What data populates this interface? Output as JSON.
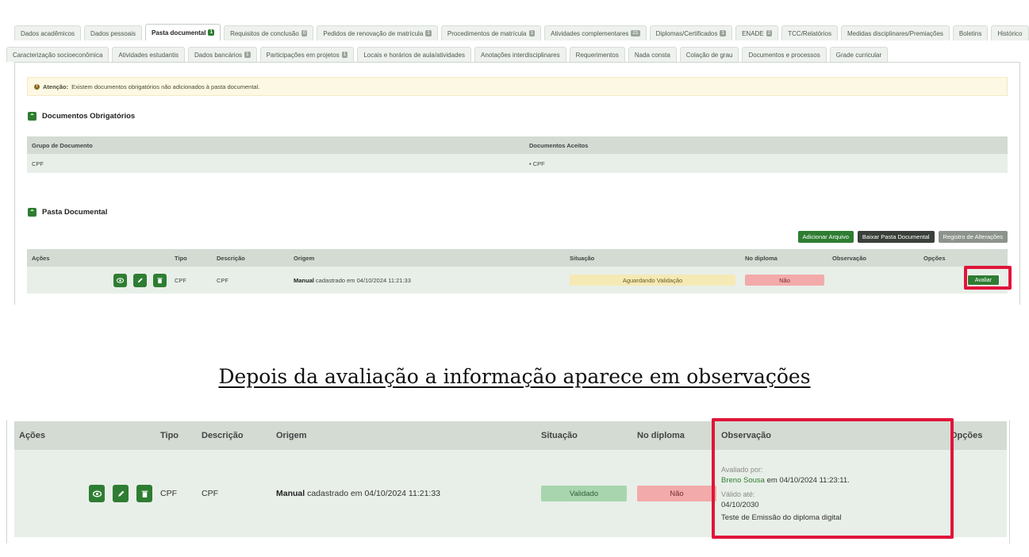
{
  "tabs_row1": [
    {
      "label": "Dados acadêmicos"
    },
    {
      "label": "Dados pessoais"
    },
    {
      "label": "Pasta documental",
      "badge": "1",
      "active": true
    },
    {
      "label": "Requisitos de conclusão",
      "badge": "0"
    },
    {
      "label": "Pedidos de renovação de matrícula",
      "badge": "1"
    },
    {
      "label": "Procedimentos de matrícula",
      "badge": "1"
    },
    {
      "label": "Atividades complementares",
      "badge": "21"
    },
    {
      "label": "Diplomas/Certificados",
      "badge": "1"
    },
    {
      "label": "ENADE",
      "badge": "2"
    },
    {
      "label": "TCC/Relatórios"
    },
    {
      "label": "Medidas disciplinares/Premiações"
    },
    {
      "label": "Boletins"
    },
    {
      "label": "Histórico"
    }
  ],
  "tabs_row2": [
    {
      "label": "Caracterização socioeconômica"
    },
    {
      "label": "Atividades estudantis"
    },
    {
      "label": "Dados bancários",
      "badge": "1"
    },
    {
      "label": "Participações em projetos",
      "badge": "1"
    },
    {
      "label": "Locais e horários de aula/atividades"
    },
    {
      "label": "Anotações interdisciplinares"
    },
    {
      "label": "Requerimentos"
    },
    {
      "label": "Nada consta"
    },
    {
      "label": "Colação de grau"
    },
    {
      "label": "Documentos e processos"
    },
    {
      "label": "Grade curricular"
    }
  ],
  "alert": {
    "strong": "Atenção:",
    "text": " Existem documentos obrigatórios não adicionados à pasta documental."
  },
  "obrigatorios": {
    "title": "Documentos Obrigatórios",
    "headers": [
      "Grupo de Documento",
      "Documentos Aceitos"
    ],
    "row": {
      "grupo": "CPF",
      "aceitos": "• CPF"
    }
  },
  "pasta": {
    "title": "Pasta Documental",
    "actions": {
      "add": "Adicionar Arquivo",
      "download": "Baixar Pasta Documental",
      "log": "Registro de Alterações"
    },
    "headers": {
      "acoes": "Ações",
      "tipo": "Tipo",
      "descricao": "Descrição",
      "origem": "Origem",
      "situacao": "Situação",
      "no_diploma": "No diploma",
      "observacao": "Observação",
      "opcoes": "Opções"
    },
    "row": {
      "tipo": "CPF",
      "descricao": "CPF",
      "origem_strong": "Manual",
      "origem_text": " cadastrado em 04/10/2024 11:21:33",
      "situacao": "Aguardando Validação",
      "no_diploma": "Não",
      "avaliar": "Avaliar"
    }
  },
  "caption": "Depois da avaliação a informação aparece em observações",
  "after": {
    "headers": {
      "acoes": "Ações",
      "tipo": "Tipo",
      "descricao": "Descrição",
      "origem": "Origem",
      "situacao": "Situação",
      "no_diploma": "No diploma",
      "observacao": "Observação",
      "opcoes": "Opções"
    },
    "row": {
      "tipo": "CPF",
      "descricao": "CPF",
      "origem_strong": "Manual",
      "origem_text": " cadastrado em 04/10/2024 11:21:33",
      "situacao": "Validado",
      "no_diploma": "Não",
      "obs_label1": "Avaliado por:",
      "obs_user": "Breno Sousa",
      "obs_when": " em 04/10/2024 11:23:11.",
      "obs_label2": "Válido até:",
      "obs_valid": "04/10/2030",
      "obs_note": "Teste de Emissão do diploma digital"
    }
  },
  "colors": {
    "primary": "#2e7d32",
    "highlight": "#e0153a",
    "alert_bg": "#fcf8e3",
    "header_bg": "#d3dbd3",
    "row_bg": "#e8efe8"
  },
  "icons": {
    "view": "eye-icon",
    "edit": "pencil-icon",
    "delete": "trash-icon",
    "collapse": "chevron-up-icon",
    "warning": "exclamation-icon"
  }
}
